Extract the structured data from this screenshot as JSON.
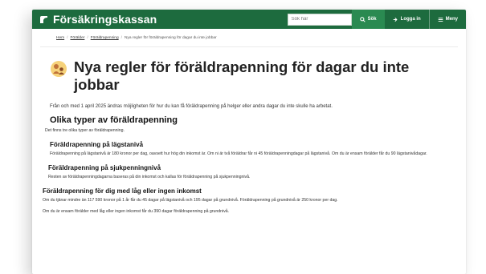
{
  "header": {
    "logo_text": "Försäkringskassan",
    "search_placeholder": "Sök här",
    "search_button": "Sök",
    "login_button": "Logga in",
    "menu_button": "Meny"
  },
  "breadcrumb": {
    "items": [
      "Hem",
      "Förälder",
      "Föräldrapenning"
    ],
    "current": "Nya regler för föräldrapenning för dagar du inte jobbar"
  },
  "main": {
    "title": "Nya regler för föräldrapenning för dagar du inte jobbar",
    "lead": "Från och med 1 april 2025 ändras möjligheten för hur du kan få föräldrapenning på helger eller andra dagar du inte skulle ha arbetat.",
    "section_title": "Olika typer av föräldrapenning",
    "section_intro": "Det finns tre olika typer av föräldrapenning.",
    "sub1_title": "Föräldrapenning på lägstanivå",
    "sub1_text": "Föräldrapenning på lägstanivå är 180 kronor per dag, oavsett hur hög din inkomst är. Om ni är två föräldrar får ni 45 föräldrapenningdagar på lägstanivå. Om du är ensam förälder får du 90 lägstanivådagar.",
    "sub2_title": "Föräldrapenning på sjukpenningnivå",
    "sub2_text": "Resten av föräldrapenningdagarna baseras på din inkomst och kallas för föräldrapenning på sjukpenningnivå.",
    "sub3_title": "Föräldrapenning för dig med låg eller ingen inkomst",
    "sub3_text": "Om du tjänar mindre än 117 590 kronor på 1 år får du 45 dagar på lägstanivå och 195 dagar på grundnivå. Föräldrapenning på grundnivå är 250 kronor per dag.",
    "sub3_text2": "Om du är ensam förälder med låg eller ingen inkomst får du 390 dagar föräldrapenning på grundnivå."
  },
  "colors": {
    "brand": "#1d6b3e",
    "brand_light": "#2a8a51"
  }
}
